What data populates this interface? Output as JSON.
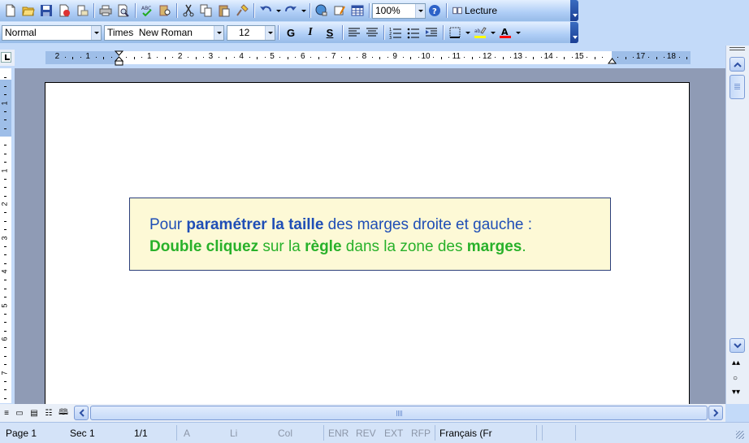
{
  "toolbar_standard": {
    "icons": [
      "new-document-icon",
      "open-folder-icon",
      "save-icon",
      "permission-icon",
      "email-icon",
      "print-icon",
      "print-preview-icon",
      "spelling-icon",
      "research-icon",
      "cut-icon",
      "copy-icon",
      "paste-icon",
      "format-painter-icon",
      "undo-icon",
      "redo-icon",
      "hyperlink-icon",
      "tables-borders-icon",
      "insert-table-icon",
      "help-icon"
    ],
    "zoom": "100%",
    "reading_label": "Lecture"
  },
  "toolbar_formatting": {
    "style": "Normal",
    "font": "Times  New Roman",
    "size": "12",
    "bold_label": "G",
    "italic_label": "I",
    "underline_label": "S",
    "highlight_color": "#ffff00",
    "font_color": "#ff0000"
  },
  "ruler": {
    "labels": [
      "2",
      "1",
      "1",
      "2",
      "3",
      "4",
      "5",
      "6",
      "7",
      "8",
      "9",
      "10",
      "11",
      "12",
      "13",
      "14",
      "15",
      "17",
      "18"
    ]
  },
  "vruler": {
    "labels": [
      "1",
      "1",
      "2",
      "3",
      "4",
      "5",
      "6",
      "7"
    ]
  },
  "document": {
    "line1": [
      {
        "text": "Pour ",
        "bold": false,
        "color": "blue"
      },
      {
        "text": "paramétrer la taille",
        "bold": true,
        "color": "blue"
      },
      {
        "text": " des marges droite et gauche :",
        "bold": false,
        "color": "blue"
      }
    ],
    "line2": [
      {
        "text": "Double cliquez",
        "bold": true,
        "color": "green"
      },
      {
        "text": " sur la ",
        "bold": false,
        "color": "green"
      },
      {
        "text": "règle",
        "bold": true,
        "color": "green"
      },
      {
        "text": " dans la zone des ",
        "bold": false,
        "color": "green"
      },
      {
        "text": "marges",
        "bold": true,
        "color": "green"
      },
      {
        "text": ".",
        "bold": false,
        "color": "green"
      }
    ]
  },
  "statusbar": {
    "page": "Page 1",
    "section": "Sec 1",
    "pages": "1/1",
    "at": "A",
    "line": "Li",
    "col": "Col",
    "rec": "ENR",
    "trk": "REV",
    "ext": "EXT",
    "ovr": "RFP",
    "language": "Français (Fr"
  },
  "colors": {
    "text_blue": "#1f4eb6",
    "text_green": "#28b12a",
    "callout_bg": "#fdf9d6",
    "toolbar_blue": "#c3daf9"
  }
}
